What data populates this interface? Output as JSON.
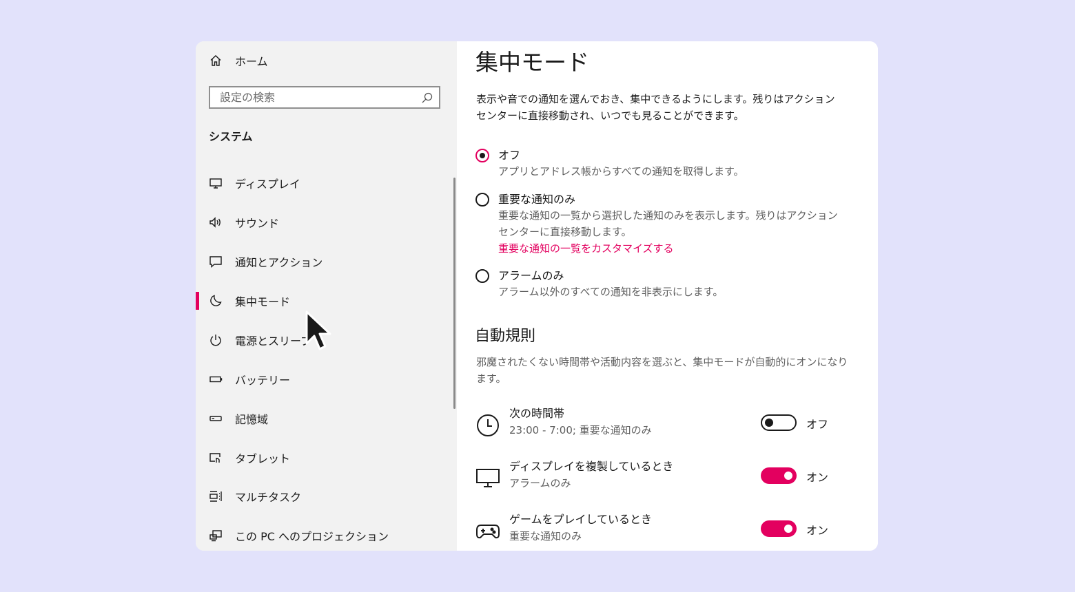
{
  "sidebar": {
    "home_label": "ホーム",
    "search_placeholder": "設定の検索",
    "section_title": "システム",
    "items": [
      {
        "label": "ディスプレイ",
        "icon": "monitor-icon"
      },
      {
        "label": "サウンド",
        "icon": "speaker-icon"
      },
      {
        "label": "通知とアクション",
        "icon": "notification-icon"
      },
      {
        "label": "集中モード",
        "icon": "moon-icon",
        "active": true
      },
      {
        "label": "電源とスリープ",
        "icon": "power-icon"
      },
      {
        "label": "バッテリー",
        "icon": "battery-icon"
      },
      {
        "label": "記憶域",
        "icon": "storage-icon"
      },
      {
        "label": "タブレット",
        "icon": "tablet-icon"
      },
      {
        "label": "マルチタスク",
        "icon": "multitask-icon"
      },
      {
        "label": "この PC へのプロジェクション",
        "icon": "projection-icon"
      }
    ]
  },
  "main": {
    "title": "集中モード",
    "description": "表示や音での通知を選んでおき、集中できるようにします。残りはアクション センターに直接移動され、いつでも見ることができます。",
    "options": [
      {
        "label": "オフ",
        "sub": "アプリとアドレス帳からすべての通知を取得します。",
        "checked": true
      },
      {
        "label": "重要な通知のみ",
        "sub": "重要な通知の一覧から選択した通知のみを表示します。残りはアクション センターに直接移動します。",
        "link": "重要な通知の一覧をカスタマイズする",
        "checked": false
      },
      {
        "label": "アラームのみ",
        "sub": "アラーム以外のすべての通知を非表示にします。",
        "checked": false
      }
    ],
    "auto_rules_title": "自動規則",
    "auto_rules_desc": "邪魔されたくない時間帯や活動内容を選ぶと、集中モードが自動的にオンになります。",
    "rules": [
      {
        "title": "次の時間帯",
        "sub": "23:00 - 7:00; 重要な通知のみ",
        "state": "オフ",
        "on": false,
        "icon": "clock-icon"
      },
      {
        "title": "ディスプレイを複製しているとき",
        "sub": "アラームのみ",
        "state": "オン",
        "on": true,
        "icon": "monitor-icon"
      },
      {
        "title": "ゲームをプレイしているとき",
        "sub": "重要な通知のみ",
        "state": "オン",
        "on": true,
        "icon": "gamepad-icon"
      }
    ]
  },
  "colors": {
    "accent": "#e3005f",
    "background": "#e2e2fb",
    "sidebar": "#f2f2f2"
  }
}
